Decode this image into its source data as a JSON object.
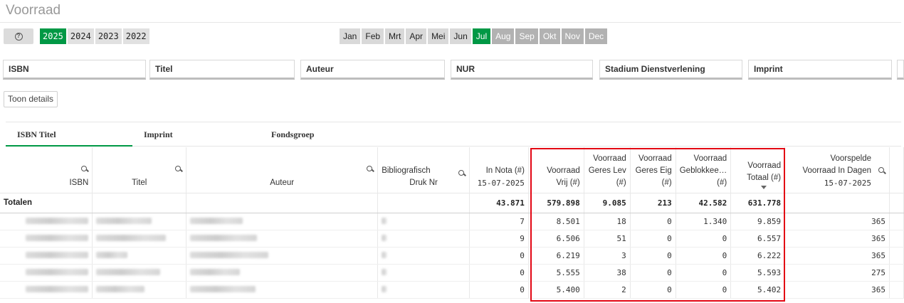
{
  "app_title": "Voorraad",
  "help_icon": "help-circle-icon",
  "years": [
    {
      "label": "2025",
      "selected": true
    },
    {
      "label": "2024",
      "selected": false
    },
    {
      "label": "2023",
      "selected": false
    },
    {
      "label": "2022",
      "selected": false
    }
  ],
  "months": [
    {
      "label": "Jan",
      "state": "normal"
    },
    {
      "label": "Feb",
      "state": "normal"
    },
    {
      "label": "Mrt",
      "state": "normal"
    },
    {
      "label": "Apr",
      "state": "normal"
    },
    {
      "label": "Mei",
      "state": "normal"
    },
    {
      "label": "Jun",
      "state": "normal"
    },
    {
      "label": "Jul",
      "state": "selected"
    },
    {
      "label": "Aug",
      "state": "disabled"
    },
    {
      "label": "Sep",
      "state": "disabled"
    },
    {
      "label": "Okt",
      "state": "disabled"
    },
    {
      "label": "Nov",
      "state": "disabled"
    },
    {
      "label": "Dec",
      "state": "disabled"
    }
  ],
  "filters": [
    "ISBN",
    "Titel",
    "Auteur",
    "NUR",
    "Stadium Dienstverlening",
    "Imprint"
  ],
  "toon_details": "Toon details",
  "tabs": [
    "ISBN Titel",
    "Imprint",
    "Fondsgroep"
  ],
  "columns": {
    "isbn": "ISBN",
    "titel": "Titel",
    "auteur": "Auteur",
    "biblio": [
      "Bibliografisch",
      "Druk Nr"
    ],
    "in_nota": [
      "In Nota (#)",
      "15-07-2025"
    ],
    "vrij": [
      "Voorraad",
      "Vrij (#)"
    ],
    "geres_lev": [
      "Voorraad",
      "Geres Lev",
      "(#)"
    ],
    "geres_eig": [
      "Voorraad",
      "Geres Eig",
      "(#)"
    ],
    "geblokkeerd": [
      "Voorraad",
      "Geblokkee…",
      "(#)"
    ],
    "totaal": [
      "Voorraad",
      "Totaal (#)"
    ],
    "voorspelde": [
      "Voorspelde",
      "Voorraad In Dagen",
      "15-07-2025"
    ]
  },
  "totals": {
    "label": "Totalen",
    "in_nota": "43.871",
    "vrij": "579.898",
    "geres_lev": "9.085",
    "geres_eig": "213",
    "geblokkeerd": "42.582",
    "totaal": "631.778"
  },
  "rows": [
    {
      "in_nota": "7",
      "vrij": "8.501",
      "geres_lev": "18",
      "geres_eig": "0",
      "geblokkeerd": "1.340",
      "totaal": "9.859",
      "voorspelde": "365"
    },
    {
      "in_nota": "9",
      "vrij": "6.506",
      "geres_lev": "51",
      "geres_eig": "0",
      "geblokkeerd": "0",
      "totaal": "6.557",
      "voorspelde": "365"
    },
    {
      "in_nota": "0",
      "vrij": "6.219",
      "geres_lev": "3",
      "geres_eig": "0",
      "geblokkeerd": "0",
      "totaal": "6.222",
      "voorspelde": "365"
    },
    {
      "in_nota": "0",
      "vrij": "5.555",
      "geres_lev": "38",
      "geres_eig": "0",
      "geblokkeerd": "0",
      "totaal": "5.593",
      "voorspelde": "275"
    },
    {
      "in_nota": "0",
      "vrij": "5.400",
      "geres_lev": "2",
      "geres_eig": "0",
      "geblokkeerd": "0",
      "totaal": "5.402",
      "voorspelde": "365"
    }
  ],
  "colors": {
    "accent": "#009845",
    "highlight": "#e30613",
    "disabled": "#b2b2b2"
  }
}
